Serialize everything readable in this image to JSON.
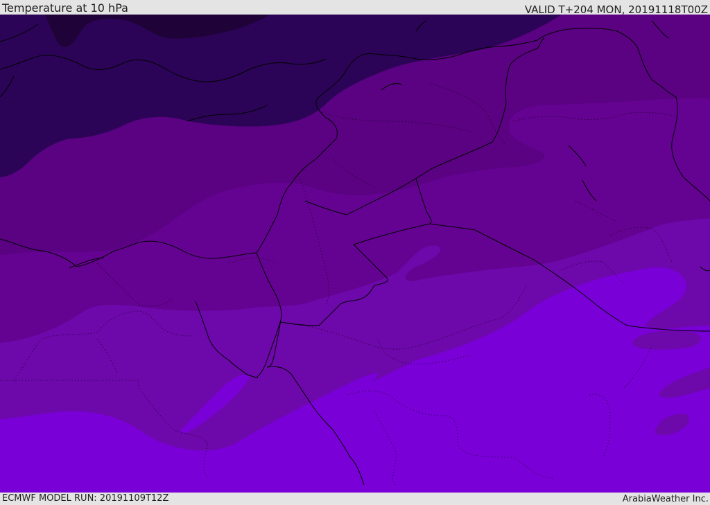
{
  "header": {
    "title": "Temperature at 10 hPa",
    "valid_time": "VALID T+204 MON, 20191118T00Z"
  },
  "footer": {
    "model_run": "ECMWF MODEL RUN: 20191109T12Z",
    "credit": "ArabiaWeather Inc."
  },
  "map": {
    "layers": [
      "temperature-shading",
      "coastlines",
      "country-borders",
      "province-borders"
    ],
    "temperature_band_colors": [
      "#1f0338",
      "#2c0457",
      "#48036f",
      "#5a0282",
      "#640391",
      "#6d08aa",
      "#7a00d8"
    ],
    "coastline_color": "#000000",
    "border_color": "#000000"
  }
}
